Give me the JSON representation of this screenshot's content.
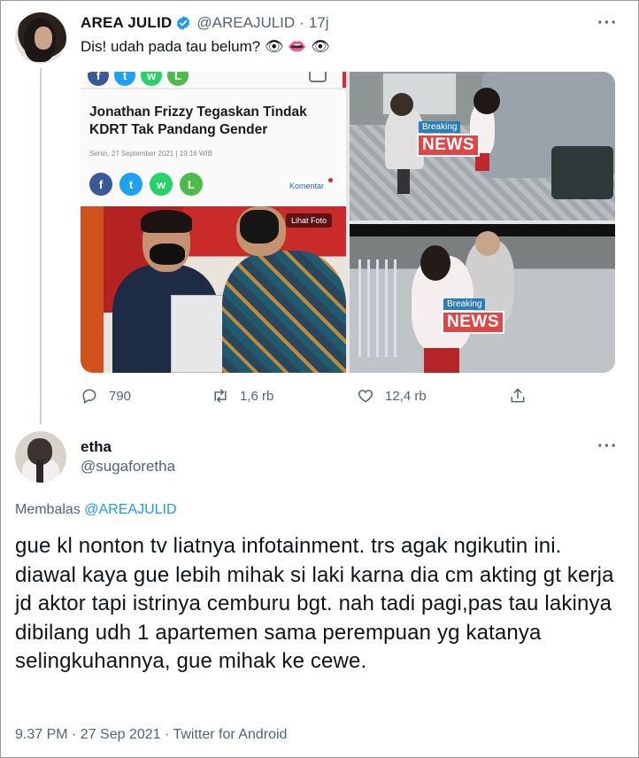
{
  "parent_tweet": {
    "display_name": "AREA JULID",
    "handle": "@AREAJULID",
    "separator": "·",
    "time": "17j",
    "text": "Dis! udah pada tau belum? 👁 👄 👁",
    "verified": true,
    "media": {
      "article_headline": "Jonathan Frizzy Tegaskan Tindak KDRT Tak Pandang Gender",
      "article_date": "Senin, 27 September 2021 | 19:16 WIB",
      "komentar_label": "Komentar",
      "lihat_foto_label": "Lihat Foto",
      "breaking_label": "Breaking",
      "news_label": "NEWS",
      "share_icons": [
        "facebook-icon",
        "twitter-icon",
        "whatsapp-icon",
        "line-icon"
      ]
    },
    "actions": {
      "reply_count": "790",
      "retweet_count": "1,6 rb",
      "like_count": "12,4 rb"
    }
  },
  "reply_tweet": {
    "display_name": "etha",
    "handle": "@sugaforetha",
    "replying_prefix": "Membalas",
    "replying_to": "@AREAJULID",
    "text": "gue kl nonton tv liatnya infotainment. trs agak ngikutin ini. diawal kaya gue lebih mihak si laki karna dia cm akting gt kerja jd aktor tapi istrinya cemburu bgt. nah tadi pagi,pas tau lakinya dibilang udh 1 apartemen sama perempuan yg katanya selingkuhannya, gue mihak ke cewe.",
    "meta": "9.37 PM · 27 Sep 2021 · Twitter for Android"
  },
  "colors": {
    "text_primary": "#0f1419",
    "text_secondary": "#536471",
    "link_blue": "#1d9bf0",
    "thread_line": "#c4cfd6",
    "news_red": "#e14646",
    "breaking_blue": "#2b7db8"
  }
}
